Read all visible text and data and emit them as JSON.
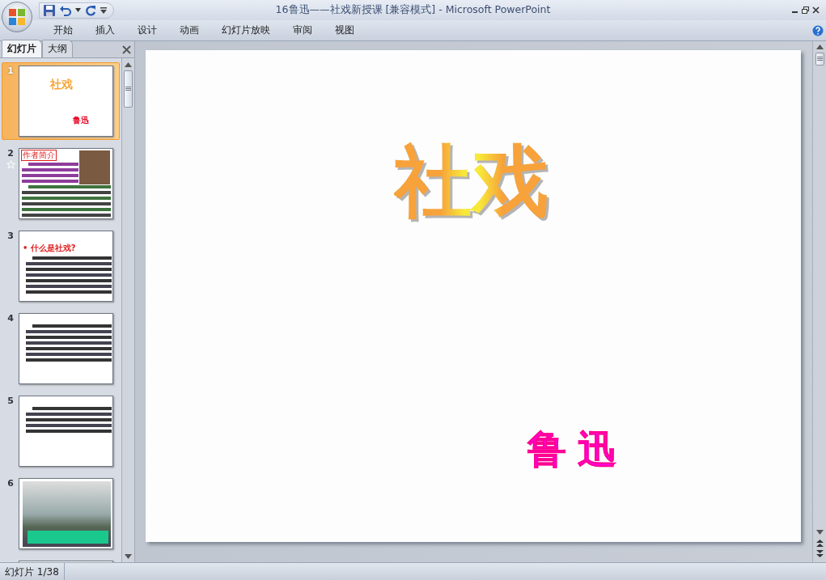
{
  "window": {
    "title": "16鲁迅——社戏新授课 [兼容模式] - Microsoft PowerPoint"
  },
  "ribbon_tabs": [
    {
      "label": "开始",
      "selected": false
    },
    {
      "label": "插入",
      "selected": false
    },
    {
      "label": "设计",
      "selected": false
    },
    {
      "label": "动画",
      "selected": false
    },
    {
      "label": "幻灯片放映",
      "selected": false
    },
    {
      "label": "审阅",
      "selected": false
    },
    {
      "label": "视图",
      "selected": false
    }
  ],
  "panel_tabs": [
    {
      "label": "幻灯片",
      "selected": true
    },
    {
      "label": "大纲",
      "selected": false
    }
  ],
  "slides": [
    {
      "number": "1",
      "kind": "title",
      "selected": true,
      "animated": false,
      "title": "社戏",
      "author": "鲁迅"
    },
    {
      "number": "2",
      "kind": "bio",
      "selected": false,
      "animated": true,
      "title": "作者简介"
    },
    {
      "number": "3",
      "kind": "text",
      "selected": false,
      "animated": false,
      "title": "• 什么是社戏?"
    },
    {
      "number": "4",
      "kind": "text",
      "selected": false,
      "animated": false
    },
    {
      "number": "5",
      "kind": "text",
      "selected": false,
      "animated": false
    },
    {
      "number": "6",
      "kind": "photo",
      "selected": false,
      "animated": false
    },
    {
      "kind": "partial",
      "selected": false,
      "animated": false
    }
  ],
  "slide": {
    "title": "社戏",
    "author": "鲁迅"
  },
  "status_bar": {
    "text": "幻灯片 1/38"
  }
}
